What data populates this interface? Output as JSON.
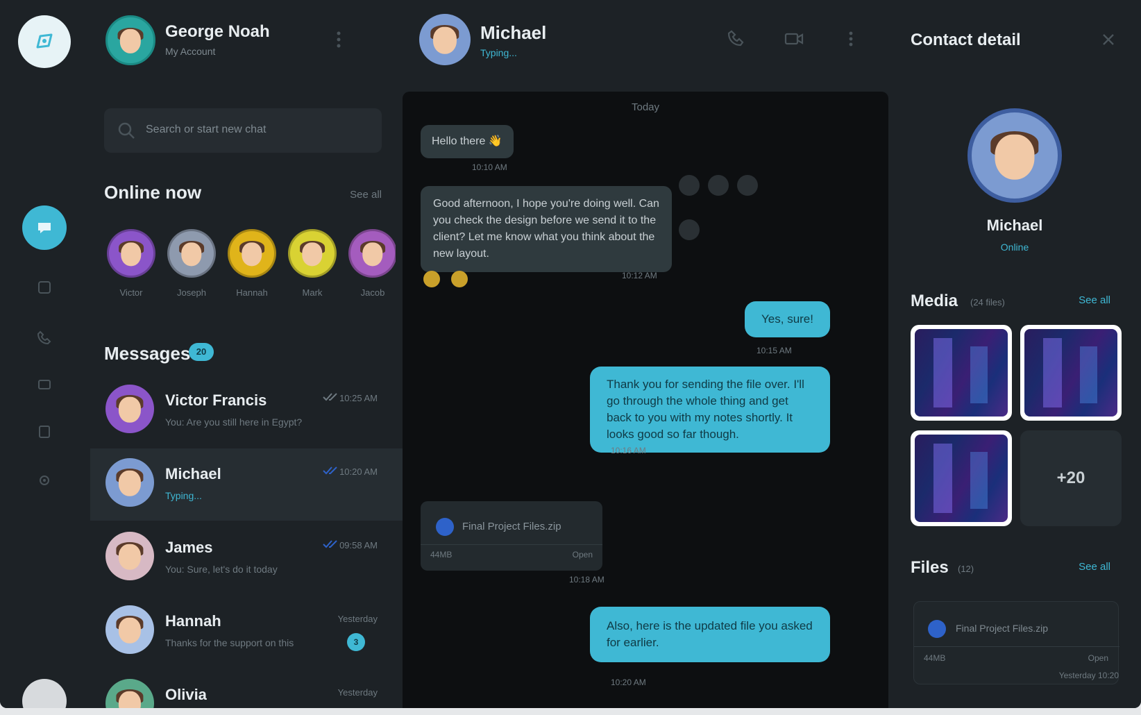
{
  "user": {
    "name": "George Noah",
    "subtitle": "My Account"
  },
  "search": {
    "placeholder": "Search or start new chat"
  },
  "online": {
    "title": "Online now",
    "see_all": "See all",
    "people": [
      {
        "name": "Victor",
        "color": "#8b55c9"
      },
      {
        "name": "Joseph",
        "color": "#8e9aae"
      },
      {
        "name": "Hannah",
        "color": "#e0b41a"
      },
      {
        "name": "Mark",
        "color": "#d9d233"
      },
      {
        "name": "Jacob",
        "color": "#a45cbe"
      }
    ]
  },
  "messages": {
    "title": "Messages",
    "count": "20",
    "items": [
      {
        "name": "Victor Francis",
        "preview": "You: Are you still here in Egypt?",
        "time": "10:25 AM",
        "color": "#8b55c9"
      },
      {
        "name": "Michael",
        "preview": "Typing...",
        "time": "10:20 AM",
        "color": "#7c9bd1"
      },
      {
        "name": "James",
        "preview": "You: Sure, let's do it today",
        "time": "09:58 AM",
        "color": "#d7b9c4"
      },
      {
        "name": "Hannah",
        "preview": "Thanks for the support on this",
        "time": "Yesterday",
        "unread": "3",
        "color": "#a8c1e6"
      },
      {
        "name": "Olivia",
        "preview": "",
        "time": "Yesterday",
        "color": "#5aa98a"
      }
    ]
  },
  "chat": {
    "name": "Michael",
    "status": "Typing...",
    "date": "Today",
    "messages": [
      {
        "dir": "in",
        "text": "Hello there 👋",
        "time": "10:10 AM"
      },
      {
        "dir": "in",
        "text": "Good afternoon, I hope you're doing well. Can you check the design before we send it to the client? Let me know what you think about the new layout.",
        "time": "10:12 AM"
      },
      {
        "dir": "out",
        "text": "Yes, sure!",
        "time": "10:15 AM"
      },
      {
        "dir": "out",
        "text": "Thank you for sending the file over. I'll go through the whole thing and get back to you with my notes shortly. It looks good so far though.",
        "time": "10:16 AM"
      },
      {
        "dir": "out",
        "text": "Also, here is the updated file you asked for earlier.",
        "time": "10:20 AM"
      }
    ],
    "file": {
      "name": "Final Project Files.zip",
      "size": "44MB",
      "open": "Open",
      "time": "10:18 AM"
    }
  },
  "contact": {
    "title": "Contact detail",
    "name": "Michael",
    "status": "Online",
    "media": {
      "label": "Media",
      "count": "(24 files)",
      "link": "See all",
      "more": "+20"
    },
    "files": {
      "label": "Files",
      "count": "(12)",
      "link": "See all",
      "name": "Final Project Files.zip",
      "size": "44MB",
      "open": "Open",
      "date": "Yesterday 10:20"
    }
  }
}
